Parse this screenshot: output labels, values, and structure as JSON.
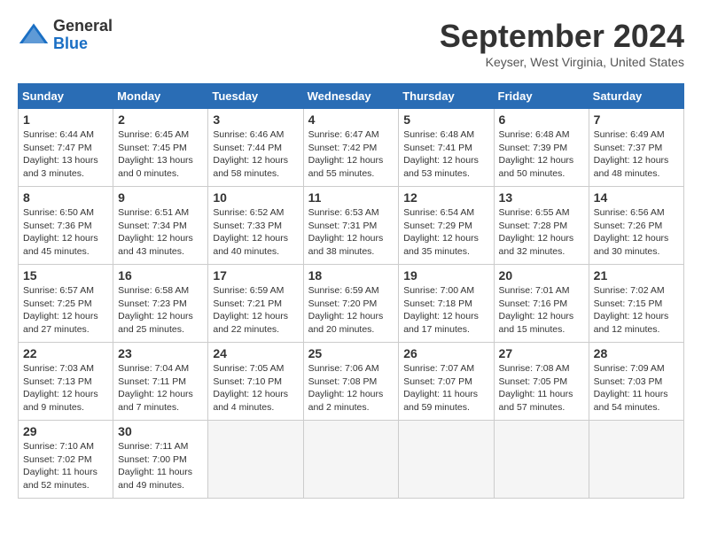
{
  "header": {
    "logo_general": "General",
    "logo_blue": "Blue",
    "month_title": "September 2024",
    "location": "Keyser, West Virginia, United States"
  },
  "days_of_week": [
    "Sunday",
    "Monday",
    "Tuesday",
    "Wednesday",
    "Thursday",
    "Friday",
    "Saturday"
  ],
  "weeks": [
    [
      {
        "day": "1",
        "sunrise": "6:44 AM",
        "sunset": "7:47 PM",
        "daylight": "13 hours and 3 minutes."
      },
      {
        "day": "2",
        "sunrise": "6:45 AM",
        "sunset": "7:45 PM",
        "daylight": "13 hours and 0 minutes."
      },
      {
        "day": "3",
        "sunrise": "6:46 AM",
        "sunset": "7:44 PM",
        "daylight": "12 hours and 58 minutes."
      },
      {
        "day": "4",
        "sunrise": "6:47 AM",
        "sunset": "7:42 PM",
        "daylight": "12 hours and 55 minutes."
      },
      {
        "day": "5",
        "sunrise": "6:48 AM",
        "sunset": "7:41 PM",
        "daylight": "12 hours and 53 minutes."
      },
      {
        "day": "6",
        "sunrise": "6:48 AM",
        "sunset": "7:39 PM",
        "daylight": "12 hours and 50 minutes."
      },
      {
        "day": "7",
        "sunrise": "6:49 AM",
        "sunset": "7:37 PM",
        "daylight": "12 hours and 48 minutes."
      }
    ],
    [
      {
        "day": "8",
        "sunrise": "6:50 AM",
        "sunset": "7:36 PM",
        "daylight": "12 hours and 45 minutes."
      },
      {
        "day": "9",
        "sunrise": "6:51 AM",
        "sunset": "7:34 PM",
        "daylight": "12 hours and 43 minutes."
      },
      {
        "day": "10",
        "sunrise": "6:52 AM",
        "sunset": "7:33 PM",
        "daylight": "12 hours and 40 minutes."
      },
      {
        "day": "11",
        "sunrise": "6:53 AM",
        "sunset": "7:31 PM",
        "daylight": "12 hours and 38 minutes."
      },
      {
        "day": "12",
        "sunrise": "6:54 AM",
        "sunset": "7:29 PM",
        "daylight": "12 hours and 35 minutes."
      },
      {
        "day": "13",
        "sunrise": "6:55 AM",
        "sunset": "7:28 PM",
        "daylight": "12 hours and 32 minutes."
      },
      {
        "day": "14",
        "sunrise": "6:56 AM",
        "sunset": "7:26 PM",
        "daylight": "12 hours and 30 minutes."
      }
    ],
    [
      {
        "day": "15",
        "sunrise": "6:57 AM",
        "sunset": "7:25 PM",
        "daylight": "12 hours and 27 minutes."
      },
      {
        "day": "16",
        "sunrise": "6:58 AM",
        "sunset": "7:23 PM",
        "daylight": "12 hours and 25 minutes."
      },
      {
        "day": "17",
        "sunrise": "6:59 AM",
        "sunset": "7:21 PM",
        "daylight": "12 hours and 22 minutes."
      },
      {
        "day": "18",
        "sunrise": "6:59 AM",
        "sunset": "7:20 PM",
        "daylight": "12 hours and 20 minutes."
      },
      {
        "day": "19",
        "sunrise": "7:00 AM",
        "sunset": "7:18 PM",
        "daylight": "12 hours and 17 minutes."
      },
      {
        "day": "20",
        "sunrise": "7:01 AM",
        "sunset": "7:16 PM",
        "daylight": "12 hours and 15 minutes."
      },
      {
        "day": "21",
        "sunrise": "7:02 AM",
        "sunset": "7:15 PM",
        "daylight": "12 hours and 12 minutes."
      }
    ],
    [
      {
        "day": "22",
        "sunrise": "7:03 AM",
        "sunset": "7:13 PM",
        "daylight": "12 hours and 9 minutes."
      },
      {
        "day": "23",
        "sunrise": "7:04 AM",
        "sunset": "7:11 PM",
        "daylight": "12 hours and 7 minutes."
      },
      {
        "day": "24",
        "sunrise": "7:05 AM",
        "sunset": "7:10 PM",
        "daylight": "12 hours and 4 minutes."
      },
      {
        "day": "25",
        "sunrise": "7:06 AM",
        "sunset": "7:08 PM",
        "daylight": "12 hours and 2 minutes."
      },
      {
        "day": "26",
        "sunrise": "7:07 AM",
        "sunset": "7:07 PM",
        "daylight": "11 hours and 59 minutes."
      },
      {
        "day": "27",
        "sunrise": "7:08 AM",
        "sunset": "7:05 PM",
        "daylight": "11 hours and 57 minutes."
      },
      {
        "day": "28",
        "sunrise": "7:09 AM",
        "sunset": "7:03 PM",
        "daylight": "11 hours and 54 minutes."
      }
    ],
    [
      {
        "day": "29",
        "sunrise": "7:10 AM",
        "sunset": "7:02 PM",
        "daylight": "11 hours and 52 minutes."
      },
      {
        "day": "30",
        "sunrise": "7:11 AM",
        "sunset": "7:00 PM",
        "daylight": "11 hours and 49 minutes."
      },
      null,
      null,
      null,
      null,
      null
    ]
  ]
}
